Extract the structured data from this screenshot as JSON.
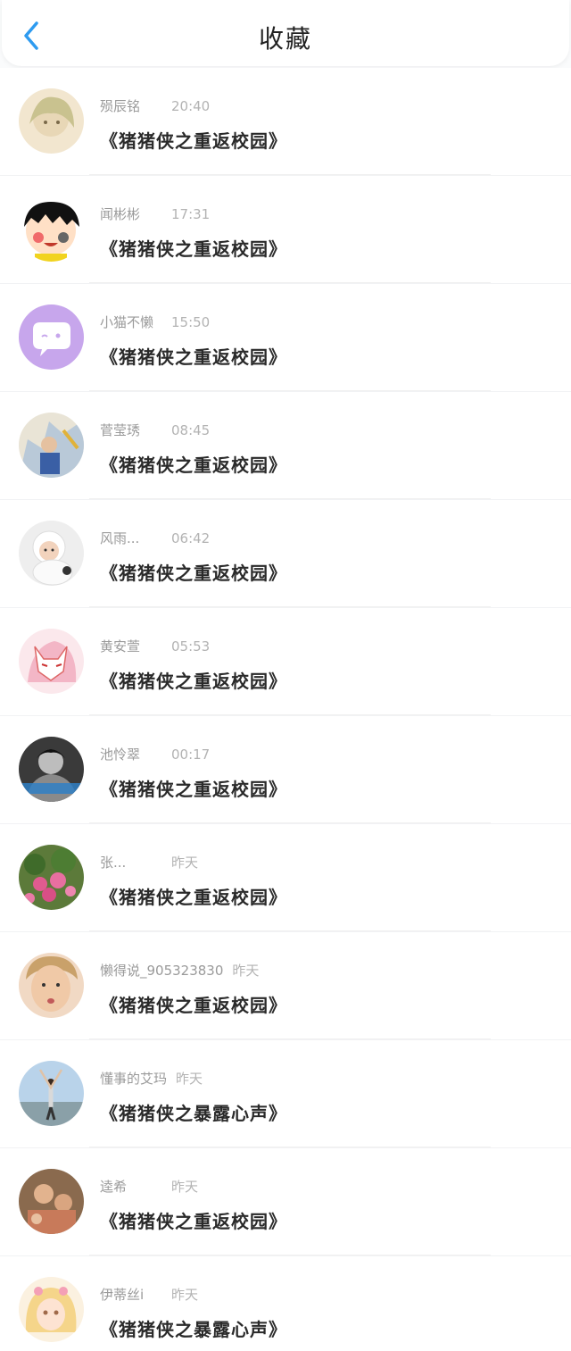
{
  "header": {
    "title": "收藏",
    "back_icon": "chevron-left-icon",
    "accent": "#2e9bf0"
  },
  "items": [
    {
      "name": "殒辰铭",
      "time": "20:40",
      "title": "《猪猪侠之重返校园》",
      "avatar": "anime-girl"
    },
    {
      "name": "闻彬彬",
      "time": "17:31",
      "title": "《猪猪侠之重返校园》",
      "avatar": "cartoon-kid"
    },
    {
      "name": "小猫不懒",
      "time": "15:50",
      "title": "《猪猪侠之重返校园》",
      "avatar": "chat-bubble"
    },
    {
      "name": "菅莹琇",
      "time": "08:45",
      "title": "《猪猪侠之重返校园》",
      "avatar": "painting"
    },
    {
      "name": "风雨...",
      "time": "06:42",
      "title": "《猪猪侠之重返校园》",
      "avatar": "baby"
    },
    {
      "name": "黄安萱",
      "time": "05:53",
      "title": "《猪猪侠之重返校园》",
      "avatar": "fox-mask"
    },
    {
      "name": "池怜翠",
      "time": "00:17",
      "title": "《猪猪侠之重返校园》",
      "avatar": "bw-photo"
    },
    {
      "name": "张...",
      "time": "昨天",
      "title": "《猪猪侠之重返校园》",
      "avatar": "flowers"
    },
    {
      "name": "懒得说_905323830",
      "time": "昨天",
      "title": "《猪猪侠之重返校园》",
      "avatar": "boy-face"
    },
    {
      "name": "懂事的艾玛",
      "time": "昨天",
      "title": "《猪猪侠之暴露心声》",
      "avatar": "beach-girl"
    },
    {
      "name": "逵希",
      "time": "昨天",
      "title": "《猪猪侠之重返校园》",
      "avatar": "group-photo"
    },
    {
      "name": "伊蒂丝i",
      "time": "昨天",
      "title": "《猪猪侠之暴露心声》",
      "avatar": "princess"
    }
  ]
}
